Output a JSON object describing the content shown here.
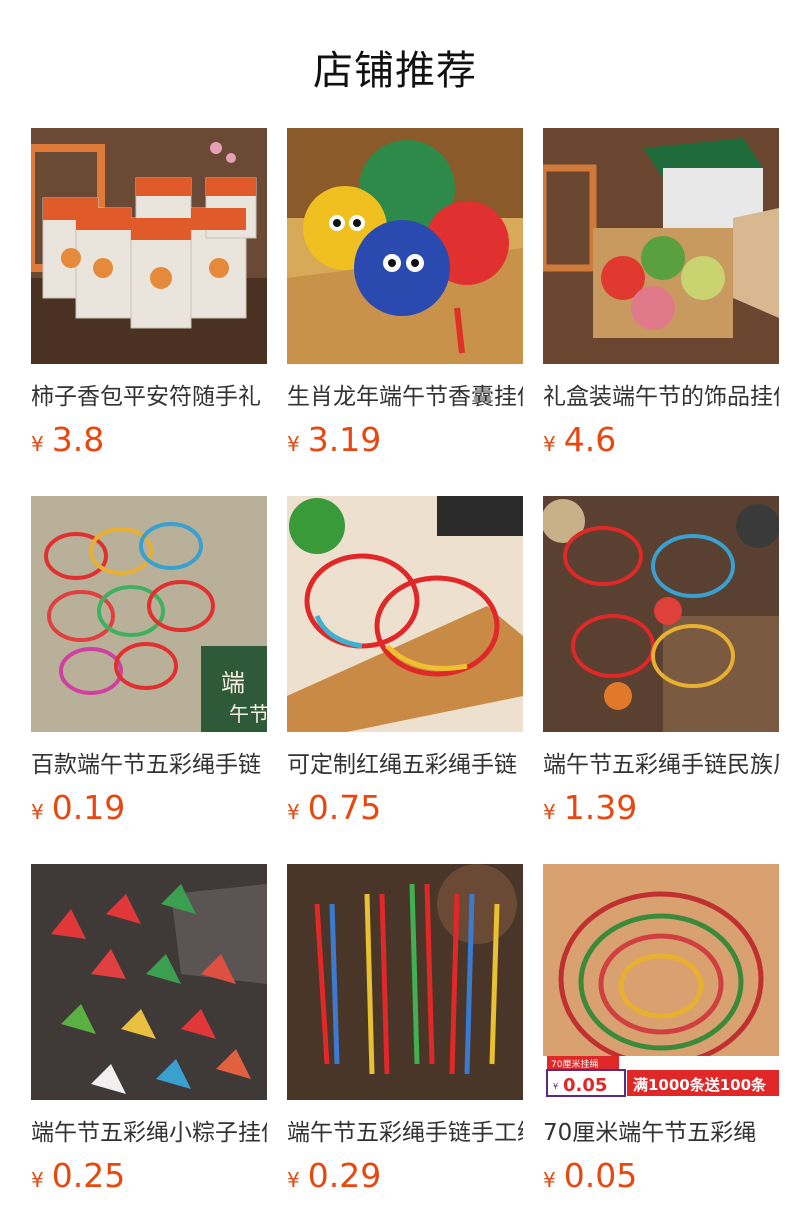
{
  "page_title": "店铺推荐",
  "currency_symbol": "¥",
  "products": [
    {
      "name": "柿子香包平安符随手礼",
      "price": "3.8"
    },
    {
      "name": "生肖龙年端午节香囊挂件",
      "price": "3.19"
    },
    {
      "name": "礼盒装端午节的饰品挂件",
      "price": "4.6"
    },
    {
      "name": "百款端午节五彩绳手链",
      "price": "0.19"
    },
    {
      "name": "可定制红绳五彩绳手链",
      "price": "0.75"
    },
    {
      "name": "端午节五彩绳手链民族风",
      "price": "1.39"
    },
    {
      "name": "端午节五彩绳小粽子挂件",
      "price": "0.25"
    },
    {
      "name": "端午节五彩绳手链手工编",
      "price": "0.29"
    },
    {
      "name": "70厘米端午节五彩绳",
      "price": "0.05"
    }
  ],
  "promo_banner": {
    "tag": "70厘米挂绳",
    "price": "0.05",
    "text": "满1000条送100条"
  }
}
